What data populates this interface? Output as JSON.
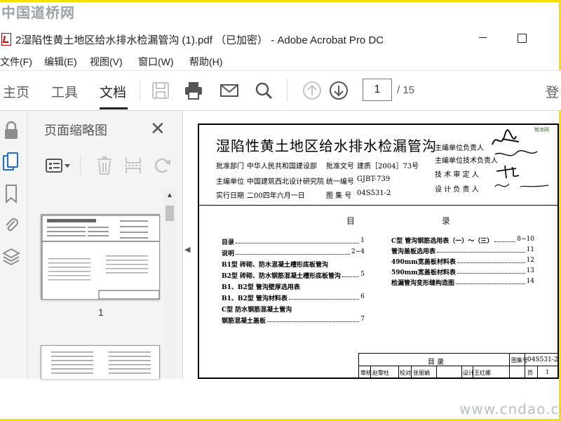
{
  "watermark_top": "中国道桥网",
  "watermark_bottom": "www.cndao.com",
  "window": {
    "title": "2湿陷性黄土地区给水排水检漏管沟 (1).pdf （已加密） - Adobe Acrobat Pro DC"
  },
  "menu": [
    "文件(F)",
    "编辑(E)",
    "视图(V)",
    "窗口(W)",
    "帮助(H)"
  ],
  "tabs": {
    "home": "主页",
    "tools": "工具",
    "document": "文档"
  },
  "toolbar": {
    "page_current": "1",
    "page_total": "/ 15",
    "sign": "登"
  },
  "icons": [
    "save-icon",
    "print-icon",
    "email-icon",
    "search-icon",
    "prev-page-icon",
    "next-page-icon"
  ],
  "thumbnails": {
    "title": "页面缩略图",
    "page1_label": "1"
  },
  "document": {
    "title": "湿陷性黄土地区给水排水检漏管沟",
    "approval_dept_label": "批准部门",
    "approval_dept": "中华人民共和国建设部",
    "approval_doc_label": "批准文号",
    "approval_doc": "建质［2004］73号",
    "editor_label": "主编单位",
    "editor": "中国建筑西北设计研究院",
    "unified_no_label": "统一编号",
    "unified_no": "GJBT-739",
    "date_label": "实行日期",
    "date": "二00四年六月一日",
    "atlas_no_label": "图 集 号",
    "atlas_no": "04S531-2",
    "roles": [
      "主编单位负责人",
      "主编单位技术负责人",
      "技 术 审 定 人",
      "设 计 负 责 人"
    ],
    "toc_title": "目 录",
    "toc_left": [
      {
        "name": "目录",
        "page": "1"
      },
      {
        "name": "说明",
        "page": "2~4"
      },
      {
        "name": "B1型  砖砌、防水混凝土槽形底板管沟",
        "page": ""
      },
      {
        "name": "B2型  砖砌、防水钢筋混凝土槽形底板管沟",
        "page": "5"
      },
      {
        "name": "B1、B2型  管沟壁厚选用表",
        "page": ""
      },
      {
        "name": "B1、B2型  管沟材料表",
        "page": "6"
      },
      {
        "name": "C型  防水钢筋混凝土管沟",
        "page": ""
      },
      {
        "name": "钢筋混凝土盖板",
        "page": "7"
      }
    ],
    "toc_right": [
      {
        "name": "C型  管沟钢筋选用表（一）～（三）",
        "page": "8~10"
      },
      {
        "name": "管沟盖板选用表",
        "page": "11"
      },
      {
        "name": "490mm宽盖板材料表",
        "page": "12"
      },
      {
        "name": "590mm宽盖板材料表",
        "page": "13"
      },
      {
        "name": "检漏管沟变形缝构造图",
        "page": "14"
      }
    ],
    "titleblock": {
      "name": "目    录",
      "atlas_label": "图集号",
      "atlas": "04S531-2",
      "review": "审核",
      "reviewer": "赵黎杜",
      "check": "校对",
      "checker": "张丽娟",
      "design": "设计",
      "designer": "王红娜",
      "page_label": "页",
      "page": "1"
    },
    "logo": "筑龙网"
  }
}
